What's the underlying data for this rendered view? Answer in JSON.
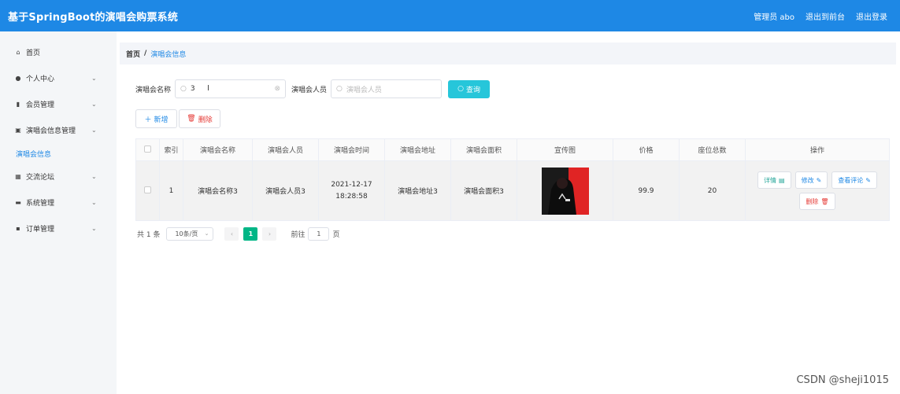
{
  "header": {
    "title": "基于SpringBoot的演唱会购票系统",
    "user_label": "管理员 abo",
    "back_label": "退出到前台",
    "logout_label": "退出登录"
  },
  "sidebar": {
    "items": [
      {
        "label": "首页",
        "icon": "home-icon",
        "glyph": "⌂"
      },
      {
        "label": "个人中心",
        "icon": "user-icon",
        "glyph": "●",
        "chevron": "⌄"
      },
      {
        "label": "会员管理",
        "icon": "bar-chart-icon",
        "glyph": "▮",
        "chevron": "⌄"
      },
      {
        "label": "演唱会信息管理",
        "icon": "clipboard-icon",
        "glyph": "▣",
        "chevron": "⌄"
      }
    ],
    "active_sub": "演唱会信息",
    "items_after": [
      {
        "label": "交流论坛",
        "icon": "grid-icon",
        "glyph": "▦",
        "chevron": "⌄"
      },
      {
        "label": "系统管理",
        "icon": "briefcase-icon",
        "glyph": "▬",
        "chevron": "⌄"
      },
      {
        "label": "订单管理",
        "icon": "chat-icon",
        "glyph": "▪",
        "chevron": "⌄"
      }
    ]
  },
  "breadcrumb": {
    "home": "首页",
    "sep": "/",
    "current": "演唱会信息"
  },
  "search": {
    "name_label": "演唱会名称",
    "name_value": "3",
    "singer_label": "演唱会人员",
    "singer_placeholder": "演唱会人员",
    "query_label": "查询"
  },
  "actions": {
    "add_label": "新增",
    "delete_label": "删除"
  },
  "table": {
    "columns": [
      "",
      "索引",
      "演唱会名称",
      "演唱会人员",
      "演唱会时间",
      "演唱会地址",
      "演唱会面积",
      "宣传图",
      "价格",
      "座位总数",
      "操作"
    ],
    "rows": [
      {
        "index": "1",
        "name": "演唱会名称3",
        "singer": "演唱会人员3",
        "time": "2021-12-17 18:28:58",
        "address": "演唱会地址3",
        "area": "演唱会面积3",
        "price": "99.9",
        "seats": "20"
      }
    ],
    "row_ops": {
      "detail": "详情",
      "edit": "修改",
      "review": "查看评论",
      "delete": "删除"
    }
  },
  "pager": {
    "total": "共 1 条",
    "page_size": "10条/页",
    "current_page": "1",
    "goto_prefix": "前往",
    "goto_value": "1",
    "goto_suffix": "页"
  },
  "watermark": "CSDN @sheji1015",
  "colors": {
    "header": "#1e88e5",
    "query_button": "#26c6da",
    "active_page": "#00b686",
    "danger": "#e53935"
  }
}
